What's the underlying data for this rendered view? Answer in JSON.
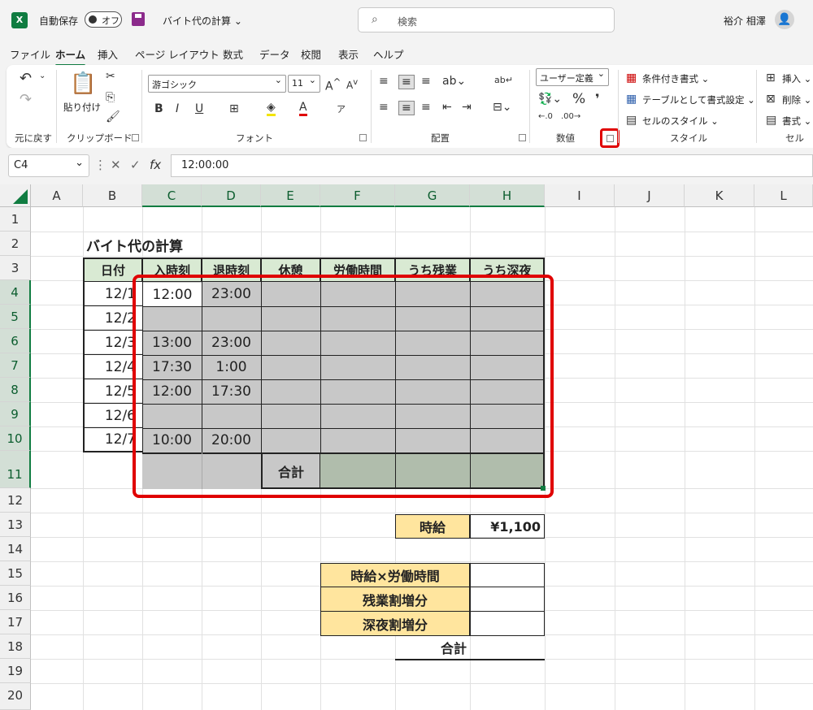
{
  "app": {
    "logo": "X",
    "autosave_label": "自動保存",
    "autosave_state": "オフ",
    "doc_title": "バイト代の計算 ⌄",
    "search_placeholder": "検索",
    "user_name": "裕介 相澤"
  },
  "menu": [
    "ファイル",
    "ホーム",
    "挿入",
    "ページ レイアウト",
    "数式",
    "データ",
    "校閲",
    "表示",
    "ヘルプ"
  ],
  "ribbon": {
    "groups": {
      "undo": "元に戻す",
      "clipboard": "クリップボード",
      "font": "フォント",
      "align": "配置",
      "number": "数値",
      "styles": "スタイル",
      "cells": "セル"
    },
    "paste": "貼り付け",
    "font_name": "游ゴシック",
    "font_size": "11",
    "number_format": "ユーザー定義",
    "cond_format": "条件付き書式 ⌄",
    "table_format": "テーブルとして書式設定 ⌄",
    "cell_styles": "セルのスタイル ⌄",
    "insert": "挿入 ⌄",
    "delete": "削除 ⌄",
    "format": "書式 ⌄"
  },
  "formula_bar": {
    "name_box": "C4",
    "formula": "12:00:00"
  },
  "columns": [
    "A",
    "B",
    "C",
    "D",
    "E",
    "F",
    "G",
    "H",
    "I",
    "J",
    "K",
    "L"
  ],
  "rows": [
    "1",
    "2",
    "3",
    "4",
    "5",
    "6",
    "7",
    "8",
    "9",
    "10",
    "11",
    "12",
    "13",
    "14",
    "15",
    "16",
    "17",
    "18",
    "19",
    "20"
  ],
  "sheet": {
    "title": "バイト代の計算",
    "headers": [
      "日付",
      "入時刻",
      "退時刻",
      "休憩",
      "労働時間",
      "うち残業",
      "うち深夜"
    ],
    "data": [
      [
        "12/1",
        "12:00",
        "23:00"
      ],
      [
        "12/2",
        "",
        ""
      ],
      [
        "12/3",
        "13:00",
        "23:00"
      ],
      [
        "12/4",
        "17:30",
        "1:00"
      ],
      [
        "12/5",
        "12:00",
        "17:30"
      ],
      [
        "12/6",
        "",
        ""
      ],
      [
        "12/7",
        "10:00",
        "20:00"
      ]
    ],
    "total_label": "合計",
    "wage_label": "時給",
    "wage_value": "¥1,100",
    "calc_labels": [
      "時給×労働時間",
      "残業割増分",
      "深夜割増分"
    ],
    "grand_total_label": "合計"
  }
}
